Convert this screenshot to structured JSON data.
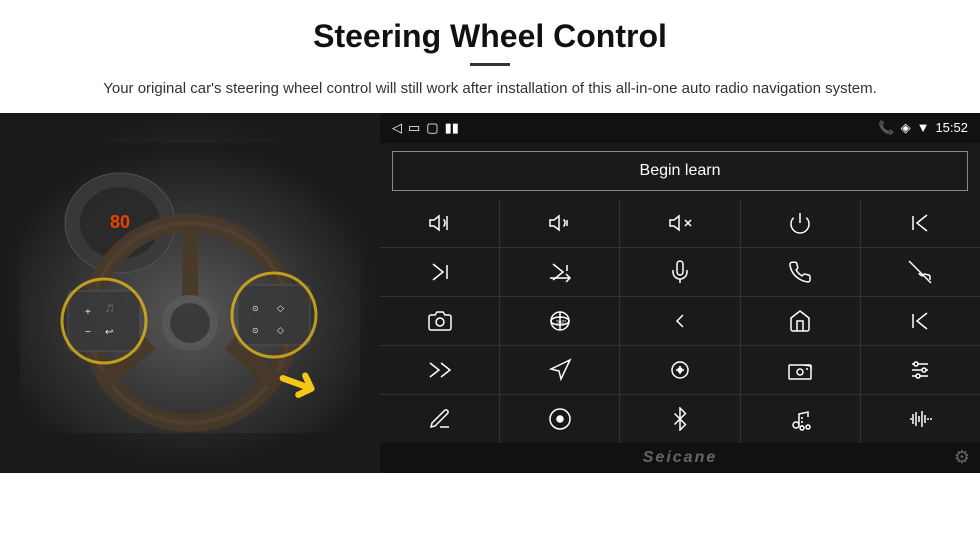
{
  "header": {
    "title": "Steering Wheel Control",
    "subtitle": "Your original car's steering wheel control will still work after installation of this all-in-one auto radio navigation system."
  },
  "panel": {
    "begin_learn_label": "Begin learn",
    "status_bar": {
      "time": "15:52",
      "back_icon": "◁",
      "home_icon": "□",
      "window_icon": "⬜",
      "sim_icon": "▮▮",
      "phone_icon": "📞",
      "location_icon": "◈",
      "signal_icon": "▼"
    }
  },
  "icon_grid": {
    "rows": [
      [
        "vol_up",
        "vol_down",
        "vol_mute",
        "power",
        "prev_track_phone"
      ],
      [
        "next_track",
        "shuffle_next",
        "mic",
        "phone",
        "end_call"
      ],
      [
        "camera",
        "360_view",
        "back_nav",
        "home_nav",
        "skip_back"
      ],
      [
        "fast_forward",
        "navigation",
        "eq",
        "radio",
        "equalizer"
      ],
      [
        "pen",
        "circle_dot",
        "bluetooth",
        "music_settings",
        "waveform"
      ]
    ]
  },
  "branding": {
    "watermark": "Seicane"
  }
}
